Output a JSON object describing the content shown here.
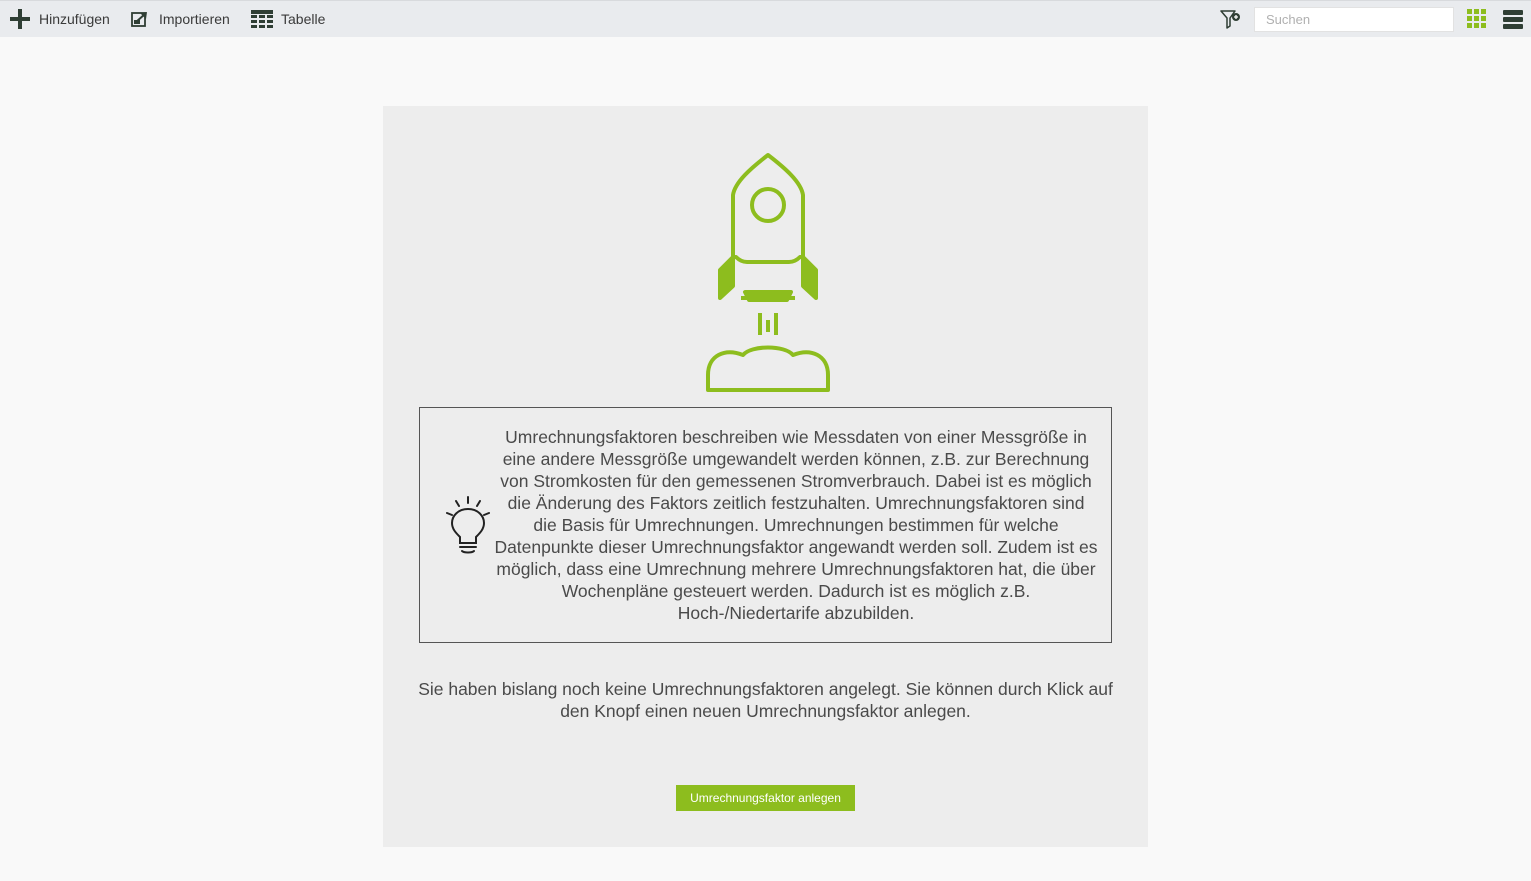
{
  "toolbar": {
    "add_label": "Hinzufügen",
    "import_label": "Importieren",
    "table_label": "Tabelle",
    "search_placeholder": "Suchen",
    "search_value": ""
  },
  "icons": {
    "add": "plus-icon",
    "import": "import-icon",
    "table": "table-icon",
    "filter": "filter-icon",
    "tiles_view": "grid-view-icon",
    "list_view": "list-view-icon",
    "illustration": "rocket-icon",
    "hint": "lightbulb-icon"
  },
  "colors": {
    "accent": "#8dbd1e",
    "toolbar_icon": "#2f3e34",
    "toolbar_bg": "#e9ebee",
    "panel_bg": "#ededed"
  },
  "info": {
    "text": "Umrechnungsfaktoren beschreiben wie Messdaten von einer Messgröße in eine andere Messgröße umgewandelt werden können, z.B. zur Berechnung von Stromkosten für den gemessenen Stromverbrauch. Dabei ist es möglich die Änderung des Faktors zeitlich festzuhalten. Umrechnungsfaktoren sind die Basis für Umrechnungen. Umrechnungen bestimmen für welche Datenpunkte dieser Umrechnungsfaktor angewandt werden soll. Zudem ist es möglich, dass eine Umrechnung mehrere Umrechnungsfaktoren hat, die über Wochenpläne gesteuert werden. Dadurch ist es möglich z.B. Hoch-/Niedertarife abzubilden."
  },
  "empty_state": {
    "text": "Sie haben bislang noch keine Umrechnungsfaktoren angelegt. Sie können durch Klick auf den Knopf einen neuen Umrechnungsfaktor anlegen.",
    "button_label": "Umrechnungsfaktor anlegen"
  }
}
